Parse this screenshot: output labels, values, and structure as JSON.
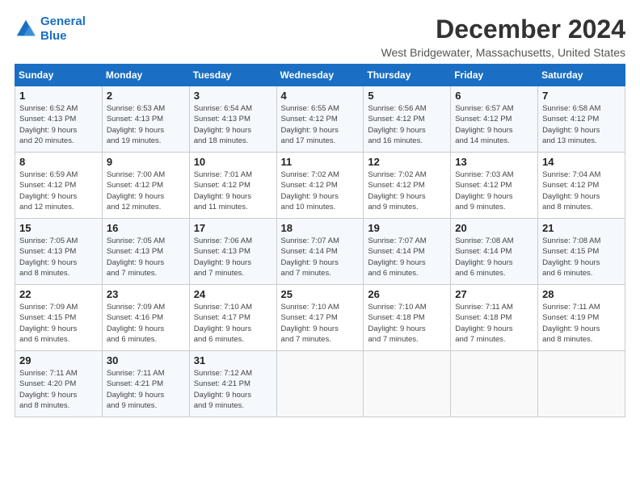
{
  "logo": {
    "line1": "General",
    "line2": "Blue"
  },
  "header": {
    "month": "December 2024",
    "location": "West Bridgewater, Massachusetts, United States"
  },
  "weekdays": [
    "Sunday",
    "Monday",
    "Tuesday",
    "Wednesday",
    "Thursday",
    "Friday",
    "Saturday"
  ],
  "weeks": [
    [
      {
        "day": "1",
        "lines": [
          "Sunrise: 6:52 AM",
          "Sunset: 4:13 PM",
          "Daylight: 9 hours",
          "and 20 minutes."
        ]
      },
      {
        "day": "2",
        "lines": [
          "Sunrise: 6:53 AM",
          "Sunset: 4:13 PM",
          "Daylight: 9 hours",
          "and 19 minutes."
        ]
      },
      {
        "day": "3",
        "lines": [
          "Sunrise: 6:54 AM",
          "Sunset: 4:13 PM",
          "Daylight: 9 hours",
          "and 18 minutes."
        ]
      },
      {
        "day": "4",
        "lines": [
          "Sunrise: 6:55 AM",
          "Sunset: 4:12 PM",
          "Daylight: 9 hours",
          "and 17 minutes."
        ]
      },
      {
        "day": "5",
        "lines": [
          "Sunrise: 6:56 AM",
          "Sunset: 4:12 PM",
          "Daylight: 9 hours",
          "and 16 minutes."
        ]
      },
      {
        "day": "6",
        "lines": [
          "Sunrise: 6:57 AM",
          "Sunset: 4:12 PM",
          "Daylight: 9 hours",
          "and 14 minutes."
        ]
      },
      {
        "day": "7",
        "lines": [
          "Sunrise: 6:58 AM",
          "Sunset: 4:12 PM",
          "Daylight: 9 hours",
          "and 13 minutes."
        ]
      }
    ],
    [
      {
        "day": "8",
        "lines": [
          "Sunrise: 6:59 AM",
          "Sunset: 4:12 PM",
          "Daylight: 9 hours",
          "and 12 minutes."
        ]
      },
      {
        "day": "9",
        "lines": [
          "Sunrise: 7:00 AM",
          "Sunset: 4:12 PM",
          "Daylight: 9 hours",
          "and 12 minutes."
        ]
      },
      {
        "day": "10",
        "lines": [
          "Sunrise: 7:01 AM",
          "Sunset: 4:12 PM",
          "Daylight: 9 hours",
          "and 11 minutes."
        ]
      },
      {
        "day": "11",
        "lines": [
          "Sunrise: 7:02 AM",
          "Sunset: 4:12 PM",
          "Daylight: 9 hours",
          "and 10 minutes."
        ]
      },
      {
        "day": "12",
        "lines": [
          "Sunrise: 7:02 AM",
          "Sunset: 4:12 PM",
          "Daylight: 9 hours",
          "and 9 minutes."
        ]
      },
      {
        "day": "13",
        "lines": [
          "Sunrise: 7:03 AM",
          "Sunset: 4:12 PM",
          "Daylight: 9 hours",
          "and 9 minutes."
        ]
      },
      {
        "day": "14",
        "lines": [
          "Sunrise: 7:04 AM",
          "Sunset: 4:12 PM",
          "Daylight: 9 hours",
          "and 8 minutes."
        ]
      }
    ],
    [
      {
        "day": "15",
        "lines": [
          "Sunrise: 7:05 AM",
          "Sunset: 4:13 PM",
          "Daylight: 9 hours",
          "and 8 minutes."
        ]
      },
      {
        "day": "16",
        "lines": [
          "Sunrise: 7:05 AM",
          "Sunset: 4:13 PM",
          "Daylight: 9 hours",
          "and 7 minutes."
        ]
      },
      {
        "day": "17",
        "lines": [
          "Sunrise: 7:06 AM",
          "Sunset: 4:13 PM",
          "Daylight: 9 hours",
          "and 7 minutes."
        ]
      },
      {
        "day": "18",
        "lines": [
          "Sunrise: 7:07 AM",
          "Sunset: 4:14 PM",
          "Daylight: 9 hours",
          "and 7 minutes."
        ]
      },
      {
        "day": "19",
        "lines": [
          "Sunrise: 7:07 AM",
          "Sunset: 4:14 PM",
          "Daylight: 9 hours",
          "and 6 minutes."
        ]
      },
      {
        "day": "20",
        "lines": [
          "Sunrise: 7:08 AM",
          "Sunset: 4:14 PM",
          "Daylight: 9 hours",
          "and 6 minutes."
        ]
      },
      {
        "day": "21",
        "lines": [
          "Sunrise: 7:08 AM",
          "Sunset: 4:15 PM",
          "Daylight: 9 hours",
          "and 6 minutes."
        ]
      }
    ],
    [
      {
        "day": "22",
        "lines": [
          "Sunrise: 7:09 AM",
          "Sunset: 4:15 PM",
          "Daylight: 9 hours",
          "and 6 minutes."
        ]
      },
      {
        "day": "23",
        "lines": [
          "Sunrise: 7:09 AM",
          "Sunset: 4:16 PM",
          "Daylight: 9 hours",
          "and 6 minutes."
        ]
      },
      {
        "day": "24",
        "lines": [
          "Sunrise: 7:10 AM",
          "Sunset: 4:17 PM",
          "Daylight: 9 hours",
          "and 6 minutes."
        ]
      },
      {
        "day": "25",
        "lines": [
          "Sunrise: 7:10 AM",
          "Sunset: 4:17 PM",
          "Daylight: 9 hours",
          "and 7 minutes."
        ]
      },
      {
        "day": "26",
        "lines": [
          "Sunrise: 7:10 AM",
          "Sunset: 4:18 PM",
          "Daylight: 9 hours",
          "and 7 minutes."
        ]
      },
      {
        "day": "27",
        "lines": [
          "Sunrise: 7:11 AM",
          "Sunset: 4:18 PM",
          "Daylight: 9 hours",
          "and 7 minutes."
        ]
      },
      {
        "day": "28",
        "lines": [
          "Sunrise: 7:11 AM",
          "Sunset: 4:19 PM",
          "Daylight: 9 hours",
          "and 8 minutes."
        ]
      }
    ],
    [
      {
        "day": "29",
        "lines": [
          "Sunrise: 7:11 AM",
          "Sunset: 4:20 PM",
          "Daylight: 9 hours",
          "and 8 minutes."
        ]
      },
      {
        "day": "30",
        "lines": [
          "Sunrise: 7:11 AM",
          "Sunset: 4:21 PM",
          "Daylight: 9 hours",
          "and 9 minutes."
        ]
      },
      {
        "day": "31",
        "lines": [
          "Sunrise: 7:12 AM",
          "Sunset: 4:21 PM",
          "Daylight: 9 hours",
          "and 9 minutes."
        ]
      },
      null,
      null,
      null,
      null
    ]
  ]
}
